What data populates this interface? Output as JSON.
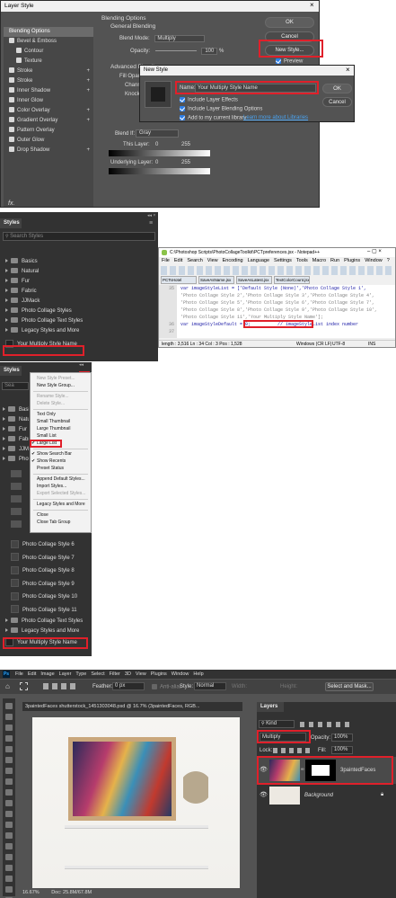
{
  "layer_style": {
    "title": "Layer Style",
    "left_items": [
      {
        "label": "Blending Options",
        "selected": true
      },
      {
        "label": "Bevel & Emboss",
        "checkbox": true
      },
      {
        "label": "Contour",
        "checkbox": true,
        "indent": true
      },
      {
        "label": "Texture",
        "checkbox": true,
        "indent": true
      },
      {
        "label": "Stroke",
        "checkbox": true,
        "plus": true
      },
      {
        "label": "Stroke",
        "checkbox": true,
        "plus": true
      },
      {
        "label": "Inner Shadow",
        "checkbox": true,
        "plus": true
      },
      {
        "label": "Inner Glow",
        "checkbox": true
      },
      {
        "label": "Color Overlay",
        "checkbox": true,
        "plus": true
      },
      {
        "label": "Gradient Overlay",
        "checkbox": true,
        "plus": true
      },
      {
        "label": "Pattern Overlay",
        "checkbox": true
      },
      {
        "label": "Outer Glow",
        "checkbox": true
      },
      {
        "label": "Drop Shadow",
        "checkbox": true,
        "plus": true
      }
    ],
    "fx": "fx.",
    "section_blending": "Blending Options",
    "general_blending": "General Blending",
    "blend_mode_label": "Blend Mode:",
    "blend_mode": "Multiply",
    "opacity_label": "Opacity:",
    "opacity_value": "100",
    "opacity_unit": "%",
    "advanced_blending": "Advanced Blending",
    "fill_opacity_partial": "Fill Opac",
    "channels_partial": "Chann",
    "knockout_partial": "Knock",
    "blend_if_label": "Blend If:",
    "blend_if_value": "Gray",
    "this_layer": "This Layer:",
    "this_layer_min": "0",
    "this_layer_max": "255",
    "underlying_layer": "Underlying Layer:",
    "underlying_min": "0",
    "underlying_max": "255",
    "ok": "OK",
    "cancel": "Cancel",
    "new_style": "New Style...",
    "preview": "Preview"
  },
  "new_style": {
    "title": "New Style",
    "name_label": "Name:",
    "name_value": "Your Multiply Style Name",
    "include_effects": "Include Layer Effects",
    "include_blending": "Include Layer Blending Options",
    "add_library": "Add to my current library",
    "learn_more": "Learn more about Libraries",
    "ok": "OK",
    "cancel": "Cancel"
  },
  "styles_panel": {
    "title": "Styles",
    "search_placeholder": "Search Styles",
    "items": [
      "Basics",
      "Natural",
      "Fur",
      "Fabric",
      "JJMack",
      "Photo Collage Styles",
      "Photo Collage Text Styles",
      "Legacy Styles and More"
    ],
    "new_item": "Your Multiply Style Name"
  },
  "notepad": {
    "title": "C:\\Photoshop Scripts\\PhotoCollageToolkit\\PCTpreferences.jsx - Notepad++",
    "menu": [
      "File",
      "Edit",
      "Search",
      "View",
      "Encoding",
      "Language",
      "Settings",
      "Tools",
      "Macro",
      "Run",
      "Plugins",
      "Window",
      "?"
    ],
    "tabs": [
      "PCTsHotel",
      "SaveAsName.jsx",
      "SaveAsLatest.jsx",
      "TextColorCount.jsx"
    ],
    "lines": [
      {
        "num": "35",
        "text": "var imageStyleList = ['Default Style (None)','Photo Collage Style 1',"
      },
      {
        "num": "",
        "text": "'Photo Collage Style 2','Photo Collage Style 3','Photo Collage Style 4',"
      },
      {
        "num": "",
        "text": "'Photo Collage Style 5','Photo Collage Style 6','Photo Collage Style 7',"
      },
      {
        "num": "",
        "text": "'Photo Collage Style 8','Photo Collage Style 9','Photo Collage Style 10',"
      },
      {
        "num": "",
        "text": "'Photo Collage Style 11','Your Multiply Style Name'];"
      },
      {
        "num": "36",
        "text": "var imageStyleDefault = 0;          // imageStyleList index number"
      },
      {
        "num": "37",
        "text": ""
      }
    ],
    "status": [
      "length : 3,516  Ln : 34    Col : 3    Pos : 1,528",
      "Windows (CR LF)",
      "UTF-8",
      "INS"
    ]
  },
  "styles_menu": {
    "title": "Styles",
    "search_partial": "Sea",
    "items": [
      "New Style Preset...",
      "New Style Group...",
      "Rename Style...",
      "Delete Style...",
      "Text Only",
      "Small Thumbnail",
      "Large Thumbnail",
      "Small List",
      "Large List",
      "Show Search Bar",
      "Show Recents",
      "Preset Status",
      "Append Default Styles...",
      "Import Styles...",
      "Export Selected Styles...",
      "Legacy Styles and More",
      "Close",
      "Close Tab Group"
    ],
    "panel_left_items": [
      "Basi",
      "Natu",
      "Fur",
      "Fabr",
      "JJMa",
      "Phot"
    ],
    "collage_items": [
      "Photo Collage Style 6",
      "Photo Collage Style 7",
      "Photo Collage Style 8",
      "Photo Collage Style 9",
      "Photo Collage Style 10",
      "Photo Collage Style 11"
    ],
    "folders_after": [
      "Photo Collage Text Styles",
      "Legacy Styles and More"
    ],
    "new_item": "Your Multiply Style Name"
  },
  "photoshop": {
    "logo": "Ps",
    "menu": [
      "File",
      "Edit",
      "Image",
      "Layer",
      "Type",
      "Select",
      "Filter",
      "3D",
      "View",
      "Plugins",
      "Window",
      "Help"
    ],
    "options": {
      "feather_label": "Feather:",
      "feather_value": "0 px",
      "anti_alias": "Anti-alias",
      "style_label": "Style:",
      "style_value": "Normal",
      "width_label": "Width:",
      "height_label": "Height:",
      "select_mask": "Select and Mask..."
    },
    "doc_tab": "3paintedFaces shutterstock_1451303048.psd @ 16.7% (3paintedFaces, RGB...",
    "zoom": "16.67%",
    "doc_size": "Doc: 25.8M/67.8M",
    "layers": {
      "title": "Layers",
      "kind": "Kind",
      "blend": "Multiply",
      "opacity_label": "Opacity:",
      "opacity_value": "100%",
      "lock_label": "Lock:",
      "fill_label": "Fill:",
      "fill_value": "100%",
      "layer1": "3paintedFaces",
      "layer2": "Background"
    }
  },
  "colors": {
    "dialog_bg": "#535353",
    "panel_bg": "#323232",
    "highlight": "#e0202a",
    "accent": "#2e7fe8"
  }
}
